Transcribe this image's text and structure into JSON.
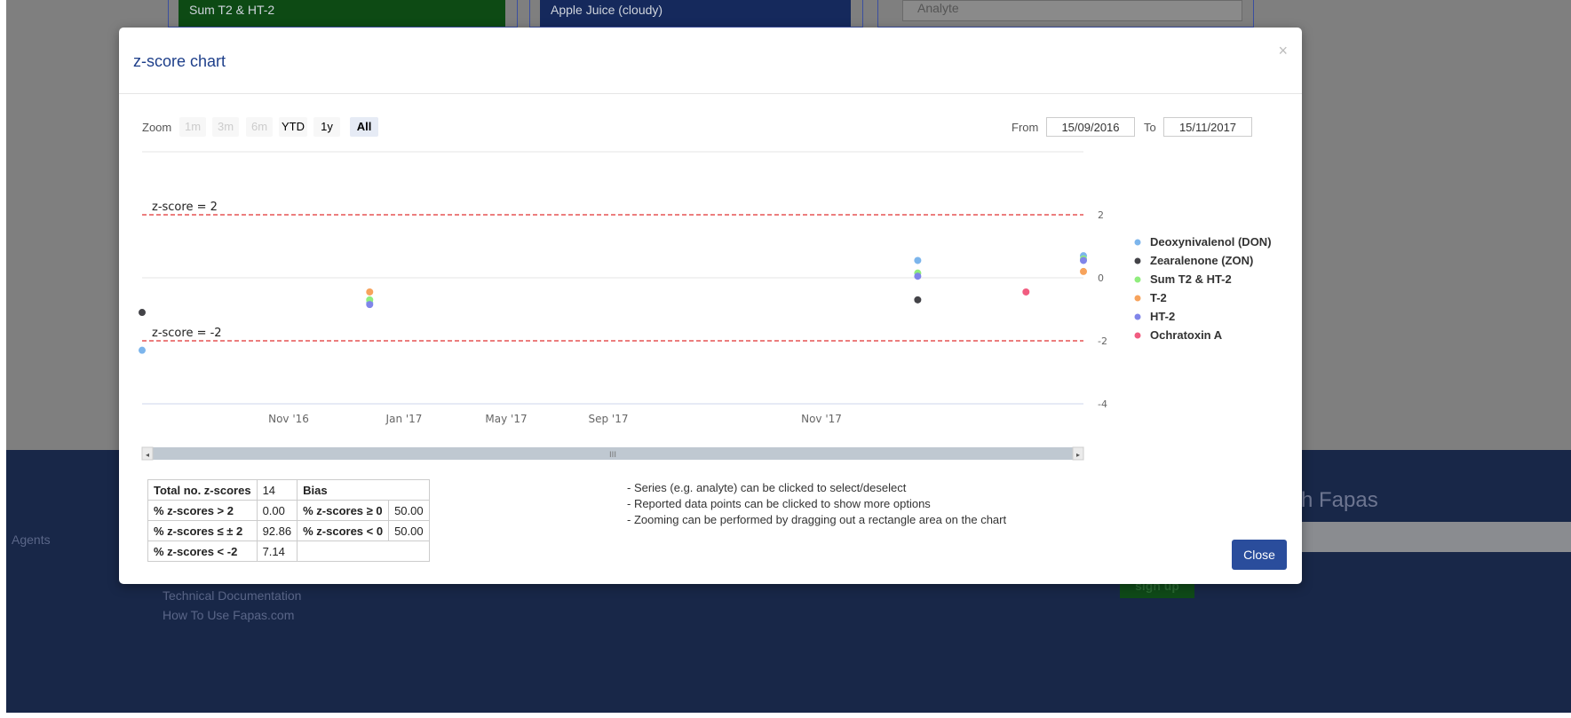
{
  "background": {
    "card_buttons": [
      "Sum T2 & HT-2",
      "Apple Juice (cloudy)"
    ],
    "analyte_select": "Analyte",
    "footer_links": [
      "Agents",
      "Technical Documentation",
      "How To Use Fapas.com"
    ],
    "fapas_heading": "h Fapas",
    "signup_label": "sign up"
  },
  "modal": {
    "title": "z-score chart",
    "close_x": "×",
    "zoom": {
      "label": "Zoom",
      "buttons": [
        "1m",
        "3m",
        "6m",
        "YTD",
        "1y",
        "All"
      ],
      "selected": "All"
    },
    "range": {
      "from_label": "From",
      "from_value": "15/09/2016",
      "to_label": "To",
      "to_value": "15/11/2017"
    },
    "stats": {
      "total_label": "Total no. z-scores",
      "total_value": "14",
      "bias_label": "Bias",
      "rows": [
        {
          "label": "% z-scores > 2",
          "value": "0.00",
          "bias_label": "% z-scores ≥ 0",
          "bias_value": "50.00"
        },
        {
          "label": "% z-scores ≤ ± 2",
          "value": "92.86",
          "bias_label": "% z-scores < 0",
          "bias_value": "50.00"
        },
        {
          "label": "% z-scores < -2",
          "value": "7.14",
          "bias_label": "",
          "bias_value": ""
        }
      ]
    },
    "notes": [
      "- Series (e.g. analyte) can be clicked to select/deselect",
      "- Reported data points can be clicked to show more options",
      "- Zooming can be performed by dragging out a rectangle area on the chart"
    ],
    "close_label": "Close"
  },
  "chart_data": {
    "type": "scatter",
    "title": "",
    "xlabel": "",
    "ylabel": "",
    "ylim": [
      -4,
      3
    ],
    "y_ticks": [
      "2",
      "0",
      "-2",
      "-4"
    ],
    "x_ticks": [
      "Nov '16",
      "Jan '17",
      "May '17",
      "Sep '17",
      "Nov '17"
    ],
    "reference_lines": [
      {
        "label": "z-score = 2",
        "value": 2
      },
      {
        "label": "z-score = -2",
        "value": -2
      }
    ],
    "legend_position": "right",
    "series": [
      {
        "name": "Deoxynivalenol (DON)",
        "color": "#7cb5ec",
        "points": [
          {
            "x": "2016-09-15",
            "y": -2.3
          },
          {
            "x": "2016-12-27",
            "y": -0.8
          },
          {
            "x": "2017-09-01",
            "y": 0.55
          },
          {
            "x": "2017-11-15",
            "y": 0.7
          }
        ]
      },
      {
        "name": "Zearalenone (ZON)",
        "color": "#434348",
        "points": [
          {
            "x": "2016-09-15",
            "y": -1.1
          },
          {
            "x": "2017-09-01",
            "y": -0.7
          }
        ]
      },
      {
        "name": "Sum T2 & HT-2",
        "color": "#90ed7d",
        "points": [
          {
            "x": "2016-12-27",
            "y": -0.7
          },
          {
            "x": "2017-09-01",
            "y": 0.15
          },
          {
            "x": "2017-11-15",
            "y": 0.6
          }
        ]
      },
      {
        "name": "T-2",
        "color": "#f7a35c",
        "points": [
          {
            "x": "2016-12-27",
            "y": -0.45
          },
          {
            "x": "2017-11-15",
            "y": 0.2
          }
        ]
      },
      {
        "name": "HT-2",
        "color": "#8085e9",
        "points": [
          {
            "x": "2016-12-27",
            "y": -0.85
          },
          {
            "x": "2017-09-01",
            "y": 0.05
          },
          {
            "x": "2017-11-15",
            "y": 0.55
          }
        ]
      },
      {
        "name": "Ochratoxin A",
        "color": "#f15c80",
        "points": [
          {
            "x": "2017-10-20",
            "y": -0.45
          }
        ]
      }
    ]
  }
}
